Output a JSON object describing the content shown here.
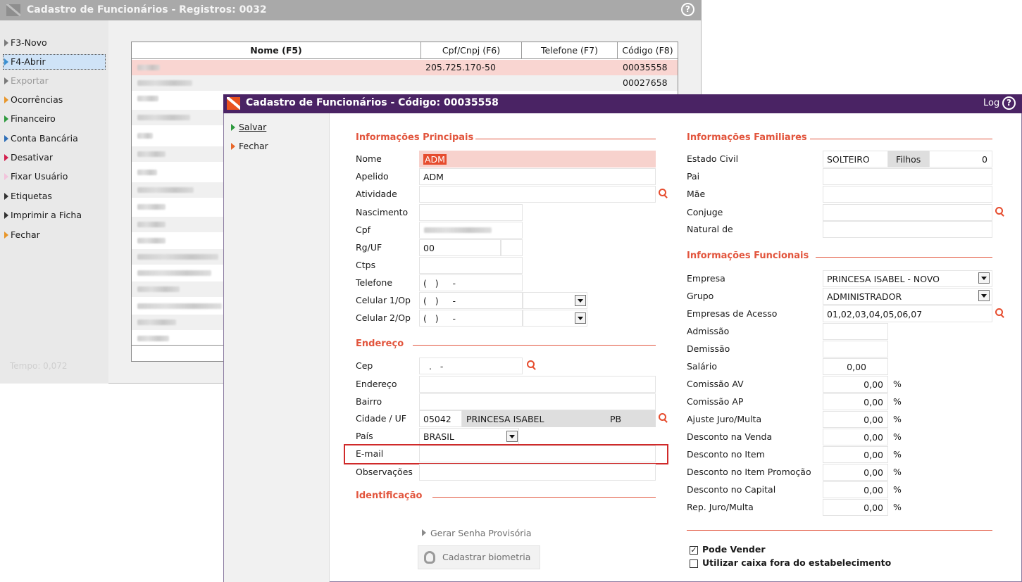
{
  "bg_window": {
    "title": "Cadastro de Funcionários - Registros: 0032",
    "help": "?",
    "menu": [
      {
        "label": "F3-Novo",
        "color": "#d8d8d8"
      },
      {
        "label": "F4-Abrir",
        "color": "#3a8fd0"
      },
      {
        "label": "Exportar",
        "color": "#9a9a9a"
      },
      {
        "label": "Ocorrências",
        "color": "#e8962a"
      },
      {
        "label": "Financeiro",
        "color": "#2e9a3e"
      },
      {
        "label": "Conta Bancária",
        "color": "#2f6fb8"
      },
      {
        "label": "Desativar",
        "color": "#d21f4d"
      },
      {
        "label": "Fixar Usuário",
        "color": "#f2c4dc"
      },
      {
        "label": "Etiquetas",
        "color": "#333333"
      },
      {
        "label": "Imprimir a Ficha",
        "color": "#333333"
      },
      {
        "label": "Fechar",
        "color": "#e8962a"
      }
    ],
    "tempo": "Tempo:  0,072",
    "table": {
      "headers": [
        "Nome (F5)",
        "Cpf/Cnpj (F6)",
        "Telefone (F7)",
        "Código (F8)"
      ],
      "rows": [
        {
          "cpf": "205.725.170-50",
          "codigo": "00035558"
        },
        {
          "cpf": "",
          "codigo": "00027658"
        }
      ]
    }
  },
  "dialog": {
    "title": "Cadastro de Funcionários - Código: 00035558",
    "log": "Log",
    "help": "?",
    "menu": {
      "salvar": "Salvar",
      "fechar": "Fechar"
    },
    "principais": {
      "title": "Informações Principais",
      "nome_label": "Nome",
      "nome": "ADM",
      "apelido_label": "Apelido",
      "apelido": "ADM",
      "atividade_label": "Atividade",
      "nascimento_label": "Nascimento",
      "cpf_label": "Cpf",
      "rg_label": "Rg/UF",
      "rg": "00",
      "ctps_label": "Ctps",
      "telefone_label": "Telefone",
      "telefone": "(   )     -",
      "celular1_label": "Celular 1/Op",
      "celular1": "(   )     -",
      "celular2_label": "Celular 2/Op",
      "celular2": "(   )     -"
    },
    "endereco": {
      "title": "Endereço",
      "cep_label": "Cep",
      "cep": "  .   -",
      "endereco_label": "Endereço",
      "bairro_label": "Bairro",
      "cidade_label": "Cidade / UF",
      "cidade_cod": "05042",
      "cidade": "PRINCESA ISABEL",
      "uf": "PB",
      "pais_label": "País",
      "pais": "BRASIL",
      "email_label": "E-mail",
      "obs_label": "Observações"
    },
    "identificacao": {
      "title": "Identificação",
      "gerar_senha": "Gerar Senha Provisória",
      "biometria": "Cadastrar biometria"
    },
    "familiares": {
      "title": "Informações Familiares",
      "estado_civil_label": "Estado Civil",
      "estado_civil": "SOLTEIRO",
      "filhos_label": "Filhos",
      "filhos": "0",
      "pai_label": "Pai",
      "mae_label": "Mãe",
      "conjuge_label": "Conjuge",
      "natural_label": "Natural de"
    },
    "funcionais": {
      "title": "Informações Funcionais",
      "empresa_label": "Empresa",
      "empresa": "PRINCESA ISABEL - NOVO",
      "grupo_label": "Grupo",
      "grupo": "ADMINISTRADOR",
      "acesso_label": "Empresas de Acesso",
      "acesso": "01,02,03,04,05,06,07",
      "admissao_label": "Admissão",
      "demissao_label": "Demissão",
      "salario_label": "Salário",
      "salario": "0,00",
      "pct_rows": [
        {
          "label": "Comissão AV",
          "value": "0,00"
        },
        {
          "label": "Comissão AP",
          "value": "0,00"
        },
        {
          "label": "Ajuste Juro/Multa",
          "value": "0,00"
        },
        {
          "label": "Desconto na Venda",
          "value": "0,00"
        },
        {
          "label": "Desconto no Item",
          "value": "0,00"
        },
        {
          "label": "Desconto no Item Promoção",
          "value": "0,00"
        },
        {
          "label": "Desconto no Capital",
          "value": "0,00"
        },
        {
          "label": "Rep. Juro/Multa",
          "value": "0,00"
        }
      ],
      "pct_symbol": "%"
    },
    "checks": {
      "pode_vender": "Pode Vender",
      "pode_vender_checked": true,
      "caixa_fora": "Utilizar caixa fora do estabelecimento",
      "caixa_fora_checked": false
    }
  },
  "colors": {
    "accent": "#e2553d",
    "dialog_title": "#4a2364",
    "highlight_row": "#f9d5d1"
  }
}
